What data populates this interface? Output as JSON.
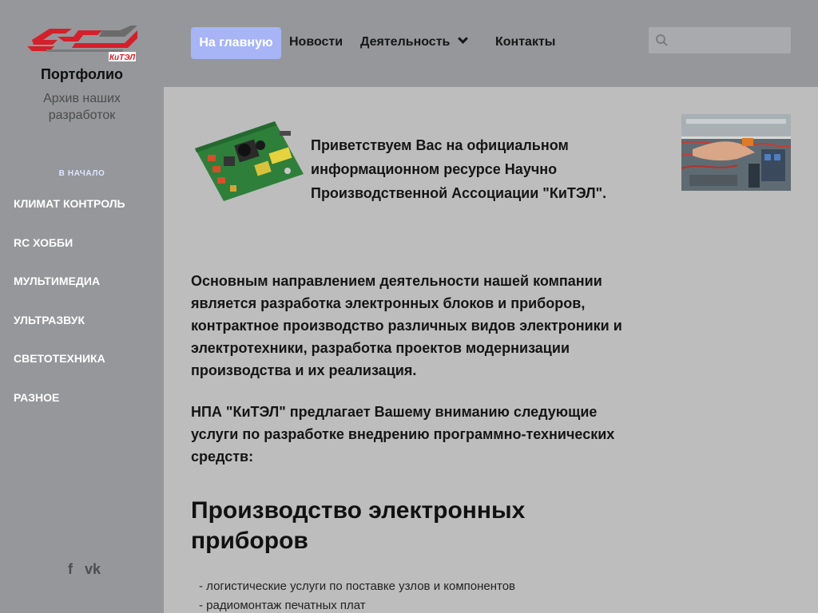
{
  "sidebar": {
    "title": "Портфолио",
    "subtitle": "Архив наших разработок",
    "start_label": "В НАЧАЛО",
    "items": [
      {
        "label": "КЛИМАТ КОНТРОЛЬ"
      },
      {
        "label": "RC ХОББИ"
      },
      {
        "label": "МУЛЬТИМЕДИА"
      },
      {
        "label": "УЛЬТРАЗВУК"
      },
      {
        "label": "СВЕТОТЕХНИКА"
      },
      {
        "label": "РАЗНОЕ"
      }
    ],
    "social": {
      "facebook": "f",
      "vk": "vk"
    }
  },
  "logo": {
    "text": "КиТЭЛ",
    "color": "#d4202a"
  },
  "topnav": {
    "home": "На главную",
    "news": "Новости",
    "activity": "Деятельность",
    "contacts": "Контакты"
  },
  "search": {
    "placeholder": ""
  },
  "main": {
    "welcome": "Приветствуем Вас на официальном информационном ресурсе Научно Производственной Ассоциации \"КиТЭЛ\".",
    "para1": "Основным направлением деятельности нашей компании является разработка электронных блоков и приборов, контрактное производство различных видов электроники и электротехники, разработка проектов модернизации производства и их реализация.",
    "para2": "НПА \"КиТЭЛ\" предлагает Вашему вниманию следующие услуги по разработке внедрению программно-технических средств:",
    "heading": "Производство электронных приборов",
    "list": [
      "- логистические услуги по поставке узлов и компонентов",
      "- радиомонтаж печатных плат"
    ]
  },
  "colors": {
    "accent": "#a7b5f7",
    "sidebar": "#96979b",
    "content_bg": "#bdbdbd"
  }
}
